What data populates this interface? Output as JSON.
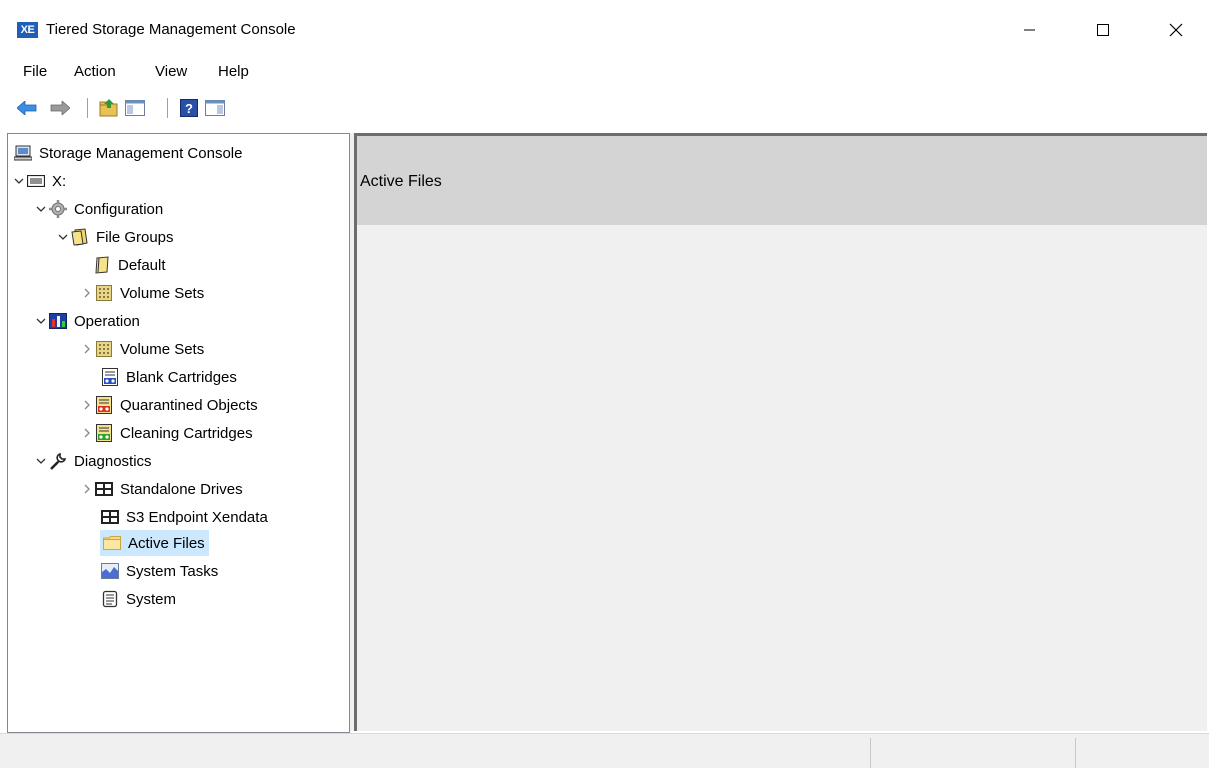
{
  "window": {
    "app_icon_text": "XE",
    "title": "Tiered Storage Management Console"
  },
  "menu": [
    "File",
    "Action",
    "View",
    "Help"
  ],
  "toolbar": {
    "buttons": [
      "back-arrow-icon",
      "forward-arrow-icon",
      "up-folder-icon",
      "show-hide-console-tree-icon",
      "help-icon",
      "show-hide-action-pane-icon"
    ]
  },
  "tree": {
    "items": [
      {
        "label": "Storage Management Console",
        "icon": "computer-icon",
        "expander": "none"
      },
      {
        "label": "X:",
        "icon": "drive-icon",
        "expander": "expanded"
      },
      {
        "label": "Configuration",
        "icon": "gear-icon",
        "expander": "expanded"
      },
      {
        "label": "File Groups",
        "icon": "file-groups-icon",
        "expander": "expanded"
      },
      {
        "label": "Default",
        "icon": "file-group-icon",
        "expander": "none"
      },
      {
        "label": "Volume Sets",
        "icon": "volume-set-icon",
        "expander": "collapsed"
      },
      {
        "label": "Operation",
        "icon": "operation-icon",
        "expander": "expanded"
      },
      {
        "label": "Volume Sets",
        "icon": "volume-set-icon",
        "expander": "collapsed"
      },
      {
        "label": "Blank Cartridges",
        "icon": "blank-cartridge-icon",
        "expander": "none"
      },
      {
        "label": "Quarantined Objects",
        "icon": "quarantine-icon",
        "expander": "collapsed"
      },
      {
        "label": "Cleaning Cartridges",
        "icon": "cleaning-cartridge-icon",
        "expander": "collapsed"
      },
      {
        "label": "Diagnostics",
        "icon": "wrench-icon",
        "expander": "expanded"
      },
      {
        "label": "Standalone Drives",
        "icon": "drives-icon",
        "expander": "collapsed"
      },
      {
        "label": "S3 Endpoint Xendata",
        "icon": "drives-icon",
        "expander": "none"
      },
      {
        "label": "Active Files",
        "icon": "folder-icon",
        "expander": "none",
        "selected": true
      },
      {
        "label": "System Tasks",
        "icon": "chart-icon",
        "expander": "none"
      },
      {
        "label": "System",
        "icon": "document-icon",
        "expander": "none"
      }
    ]
  },
  "detail": {
    "header": "Active Files"
  },
  "colors": {
    "selection": "#cce8ff",
    "detail_header": "#d4d4d4",
    "detail_bg": "#f0f0f0"
  }
}
